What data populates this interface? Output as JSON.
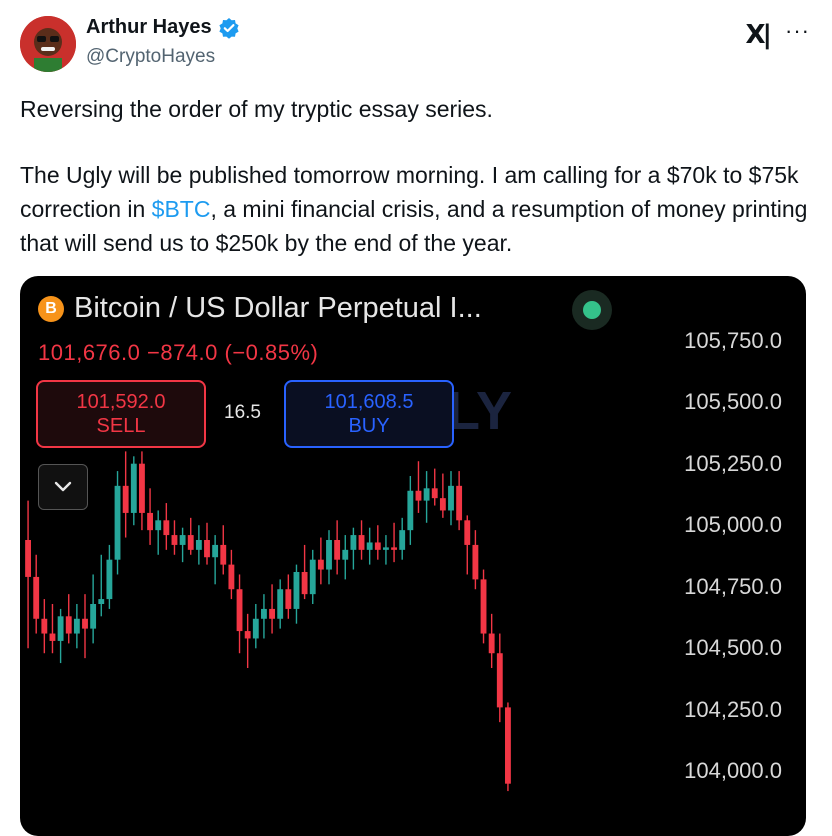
{
  "author": {
    "name": "Arthur Hayes",
    "handle": "@CryptoHayes"
  },
  "tweet": {
    "line1": "Reversing the order of my tryptic essay series.",
    "para2_before": "The Ugly will be published tomorrow morning. I am calling for a $70k to $75k correction in ",
    "cashtag": "$BTC",
    "para2_after": ", a mini financial crisis, and a resumption of money printing that will send us to $250k by the end of the year."
  },
  "chart_widget": {
    "title": "Bitcoin / US Dollar Perpetual I...",
    "btc_symbol": "B",
    "price_change": "101,676.0  −874.0 (−0.85%)",
    "sell_price": "101,592.0",
    "sell_label": "SELL",
    "spread": "16.5",
    "buy_price": "101,608.5",
    "buy_label": "BUY",
    "watermark": "ODAILY",
    "up_color": "#26a69a",
    "down_color": "#f23645"
  },
  "chart_data": {
    "type": "candlestick",
    "y_ticks": [
      "105,750.0",
      "105,500.0",
      "105,250.0",
      "105,000.0",
      "104,750.0",
      "104,500.0",
      "104,250.0",
      "104,000.0"
    ],
    "ylim": [
      103900,
      105850
    ],
    "candles": [
      {
        "o": 104940,
        "h": 105100,
        "l": 104500,
        "c": 104790
      },
      {
        "o": 104790,
        "h": 104880,
        "l": 104560,
        "c": 104620
      },
      {
        "o": 104620,
        "h": 104700,
        "l": 104480,
        "c": 104560
      },
      {
        "o": 104560,
        "h": 104680,
        "l": 104480,
        "c": 104530
      },
      {
        "o": 104530,
        "h": 104660,
        "l": 104440,
        "c": 104630
      },
      {
        "o": 104630,
        "h": 104720,
        "l": 104520,
        "c": 104560
      },
      {
        "o": 104560,
        "h": 104680,
        "l": 104500,
        "c": 104620
      },
      {
        "o": 104620,
        "h": 104720,
        "l": 104460,
        "c": 104580
      },
      {
        "o": 104580,
        "h": 104800,
        "l": 104520,
        "c": 104680
      },
      {
        "o": 104680,
        "h": 104880,
        "l": 104630,
        "c": 104700
      },
      {
        "o": 104700,
        "h": 104920,
        "l": 104660,
        "c": 104860
      },
      {
        "o": 104860,
        "h": 105220,
        "l": 104800,
        "c": 105160
      },
      {
        "o": 105160,
        "h": 105300,
        "l": 104950,
        "c": 105050
      },
      {
        "o": 105050,
        "h": 105280,
        "l": 105000,
        "c": 105250
      },
      {
        "o": 105250,
        "h": 105300,
        "l": 104980,
        "c": 105050
      },
      {
        "o": 105050,
        "h": 105150,
        "l": 104920,
        "c": 104980
      },
      {
        "o": 104980,
        "h": 105060,
        "l": 104880,
        "c": 105020
      },
      {
        "o": 105020,
        "h": 105090,
        "l": 104900,
        "c": 104960
      },
      {
        "o": 104960,
        "h": 105020,
        "l": 104880,
        "c": 104920
      },
      {
        "o": 104920,
        "h": 104990,
        "l": 104850,
        "c": 104960
      },
      {
        "o": 104960,
        "h": 105030,
        "l": 104880,
        "c": 104900
      },
      {
        "o": 104900,
        "h": 105000,
        "l": 104840,
        "c": 104940
      },
      {
        "o": 104940,
        "h": 105010,
        "l": 104840,
        "c": 104870
      },
      {
        "o": 104870,
        "h": 104960,
        "l": 104760,
        "c": 104920
      },
      {
        "o": 104920,
        "h": 105000,
        "l": 104800,
        "c": 104840
      },
      {
        "o": 104840,
        "h": 104900,
        "l": 104700,
        "c": 104740
      },
      {
        "o": 104740,
        "h": 104800,
        "l": 104480,
        "c": 104570
      },
      {
        "o": 104570,
        "h": 104640,
        "l": 104420,
        "c": 104540
      },
      {
        "o": 104540,
        "h": 104680,
        "l": 104500,
        "c": 104620
      },
      {
        "o": 104620,
        "h": 104720,
        "l": 104540,
        "c": 104660
      },
      {
        "o": 104660,
        "h": 104760,
        "l": 104560,
        "c": 104620
      },
      {
        "o": 104620,
        "h": 104780,
        "l": 104580,
        "c": 104740
      },
      {
        "o": 104740,
        "h": 104800,
        "l": 104620,
        "c": 104660
      },
      {
        "o": 104660,
        "h": 104840,
        "l": 104600,
        "c": 104810
      },
      {
        "o": 104810,
        "h": 104920,
        "l": 104700,
        "c": 104720
      },
      {
        "o": 104720,
        "h": 104900,
        "l": 104680,
        "c": 104860
      },
      {
        "o": 104860,
        "h": 104950,
        "l": 104760,
        "c": 104820
      },
      {
        "o": 104820,
        "h": 104980,
        "l": 104760,
        "c": 104940
      },
      {
        "o": 104940,
        "h": 105020,
        "l": 104800,
        "c": 104860
      },
      {
        "o": 104860,
        "h": 104960,
        "l": 104780,
        "c": 104900
      },
      {
        "o": 104900,
        "h": 104990,
        "l": 104820,
        "c": 104960
      },
      {
        "o": 104960,
        "h": 105020,
        "l": 104860,
        "c": 104900
      },
      {
        "o": 104900,
        "h": 104990,
        "l": 104840,
        "c": 104930
      },
      {
        "o": 104930,
        "h": 105000,
        "l": 104860,
        "c": 104900
      },
      {
        "o": 104900,
        "h": 104960,
        "l": 104840,
        "c": 104910
      },
      {
        "o": 104910,
        "h": 105010,
        "l": 104850,
        "c": 104900
      },
      {
        "o": 104900,
        "h": 105030,
        "l": 104860,
        "c": 104980
      },
      {
        "o": 104980,
        "h": 105200,
        "l": 104920,
        "c": 105140
      },
      {
        "o": 105140,
        "h": 105260,
        "l": 105050,
        "c": 105100
      },
      {
        "o": 105100,
        "h": 105220,
        "l": 105010,
        "c": 105150
      },
      {
        "o": 105150,
        "h": 105230,
        "l": 105080,
        "c": 105110
      },
      {
        "o": 105110,
        "h": 105210,
        "l": 105030,
        "c": 105060
      },
      {
        "o": 105060,
        "h": 105220,
        "l": 105000,
        "c": 105160
      },
      {
        "o": 105160,
        "h": 105220,
        "l": 104980,
        "c": 105020
      },
      {
        "o": 105020,
        "h": 105040,
        "l": 104800,
        "c": 104920
      },
      {
        "o": 104920,
        "h": 104980,
        "l": 104740,
        "c": 104780
      },
      {
        "o": 104780,
        "h": 104820,
        "l": 104520,
        "c": 104560
      },
      {
        "o": 104560,
        "h": 104640,
        "l": 104420,
        "c": 104480
      },
      {
        "o": 104480,
        "h": 104560,
        "l": 104200,
        "c": 104260
      },
      {
        "o": 104260,
        "h": 104280,
        "l": 103920,
        "c": 103950
      }
    ]
  }
}
